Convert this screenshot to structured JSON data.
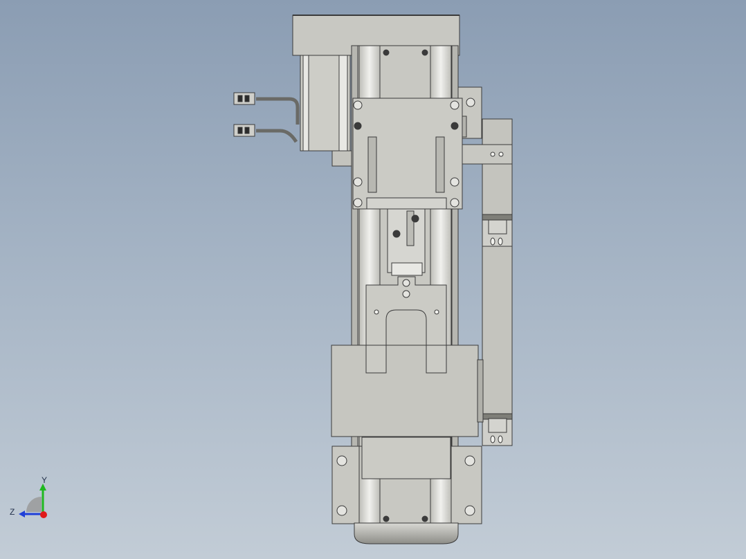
{
  "viewport": {
    "background_top": "#8b9db3",
    "background_bottom": "#c2ccd6"
  },
  "model": {
    "part_fill": "#c8c8c2",
    "part_stroke": "#3a3a3a",
    "rail_fill": "#e6e6e2",
    "shadow_fill": "#9c9c96"
  },
  "triad": {
    "y_label": "Y",
    "z_label": "Z",
    "y_color": "#1fb81f",
    "z_color": "#1f3fd8",
    "x_color": "#e01a1a"
  }
}
